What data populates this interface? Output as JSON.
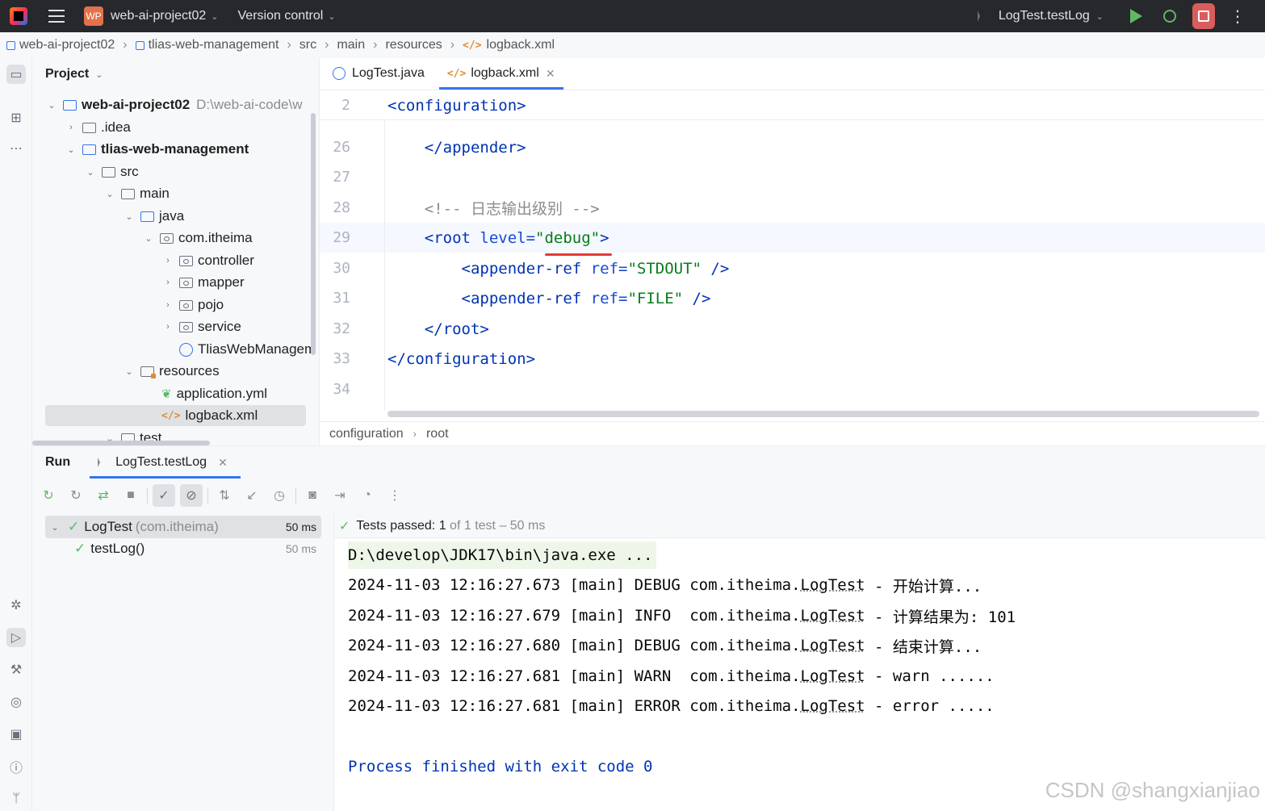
{
  "titlebar": {
    "project_badge": "WP",
    "project_name": "web-ai-project02",
    "vcs": "Version control",
    "run_config": "LogTest.testLog"
  },
  "breadcrumb": [
    "web-ai-project02",
    "tlias-web-management",
    "src",
    "main",
    "resources",
    "logback.xml"
  ],
  "project_panel": {
    "title": "Project",
    "tree": [
      {
        "label": "web-ai-project02",
        "path": "D:\\web-ai-code\\w",
        "bold": true
      },
      {
        "label": ".idea"
      },
      {
        "label": "tlias-web-management",
        "bold": true
      },
      {
        "label": "src"
      },
      {
        "label": "main"
      },
      {
        "label": "java"
      },
      {
        "label": "com.itheima"
      },
      {
        "label": "controller"
      },
      {
        "label": "mapper"
      },
      {
        "label": "pojo"
      },
      {
        "label": "service"
      },
      {
        "label": "TliasWebManagem"
      },
      {
        "label": "resources"
      },
      {
        "label": "application.yml"
      },
      {
        "label": "logback.xml"
      },
      {
        "label": "test"
      }
    ]
  },
  "editor": {
    "tabs": [
      "LogTest.java",
      "logback.xml"
    ],
    "sticky_line_number": "2",
    "lines": [
      {
        "n": "26"
      },
      {
        "n": "27"
      },
      {
        "n": "28"
      },
      {
        "n": "29"
      },
      {
        "n": "30"
      },
      {
        "n": "31"
      },
      {
        "n": "32"
      },
      {
        "n": "33"
      },
      {
        "n": "34"
      }
    ],
    "crumbs": [
      "configuration",
      "root"
    ]
  },
  "run_panel": {
    "title": "Run",
    "tab": "LogTest.testLog",
    "tests": [
      {
        "name": "LogTest",
        "pkg": "(com.itheima)",
        "duration": "50 ms"
      },
      {
        "name": "testLog()",
        "duration": "50 ms"
      }
    ],
    "status": {
      "prefix": "Tests passed:",
      "passed": "1",
      "of": "of",
      "total": "1 test",
      "time": "– 50 ms"
    },
    "console": {
      "command": "D:\\develop\\JDK17\\bin\\java.exe ...",
      "logs": [
        {
          "prefix": "2024-11-03 12:16:27.673 [main] DEBUG com.itheima.",
          "cls": "LogTest",
          "msg": " - 开始计算..."
        },
        {
          "prefix": "2024-11-03 12:16:27.679 [main] INFO  com.itheima.",
          "cls": "LogTest",
          "msg": " - 计算结果为: 101"
        },
        {
          "prefix": "2024-11-03 12:16:27.680 [main] DEBUG com.itheima.",
          "cls": "LogTest",
          "msg": " - 结束计算..."
        },
        {
          "prefix": "2024-11-03 12:16:27.681 [main] WARN  com.itheima.",
          "cls": "LogTest",
          "msg": " - warn ......"
        },
        {
          "prefix": "2024-11-03 12:16:27.681 [main] ERROR com.itheima.",
          "cls": "LogTest",
          "msg": " - error ....."
        }
      ],
      "finished": "Process finished with exit code 0"
    }
  },
  "watermark": "CSDN @shangxianjiao"
}
